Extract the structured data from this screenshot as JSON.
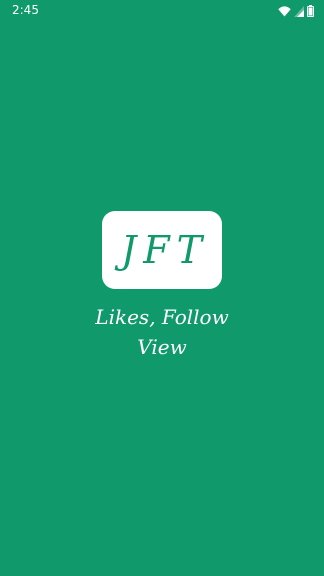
{
  "status_bar": {
    "time": "2:45",
    "icons": [
      "wifi-icon",
      "signal-icon",
      "battery-icon"
    ]
  },
  "splash": {
    "logo_text": "JFT",
    "tagline_line1": "Likes, Follow",
    "tagline_line2": "View"
  },
  "colors": {
    "background": "#109a6c",
    "logo_box": "#ffffff",
    "logo_text": "#109a6c",
    "tagline_text": "#ffffff"
  }
}
